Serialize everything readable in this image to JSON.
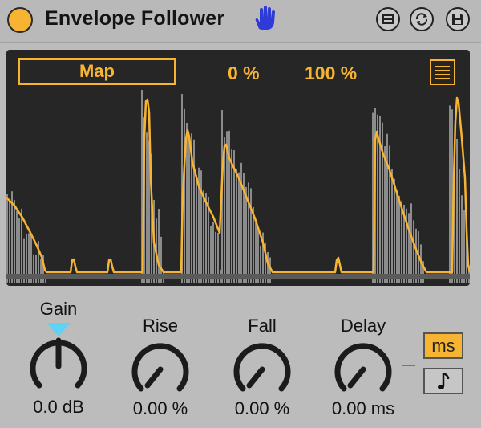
{
  "device": {
    "title": "Envelope Follower",
    "icons": {
      "power": "power-button-icon",
      "hand": "hand-icon",
      "fold": "fold-icon",
      "hotswap": "hotswap-icon",
      "save": "save-preset-icon"
    }
  },
  "display": {
    "map_label": "Map",
    "min_label": "0 %",
    "max_label": "100 %",
    "menu_icon": "menu-list-icon"
  },
  "knobs": [
    {
      "label": "Gain",
      "value": "0.0 dB",
      "level": 0.5
    },
    {
      "label": "Rise",
      "value": "0.00 %",
      "level": 0.0
    },
    {
      "label": "Fall",
      "value": "0.00 %",
      "level": 0.0
    },
    {
      "label": "Delay",
      "value": "0.00 ms",
      "level": 0.0
    }
  ],
  "delay_mode": {
    "ms_label": "ms",
    "sync_icon": "eighth-note-icon",
    "active": "ms"
  },
  "colors": {
    "accent": "#f7b432",
    "modulation": "#5fd3f3",
    "hand": "#2f3bd6",
    "display_bg": "#262626",
    "panel_bg": "#bcbcbc"
  }
}
